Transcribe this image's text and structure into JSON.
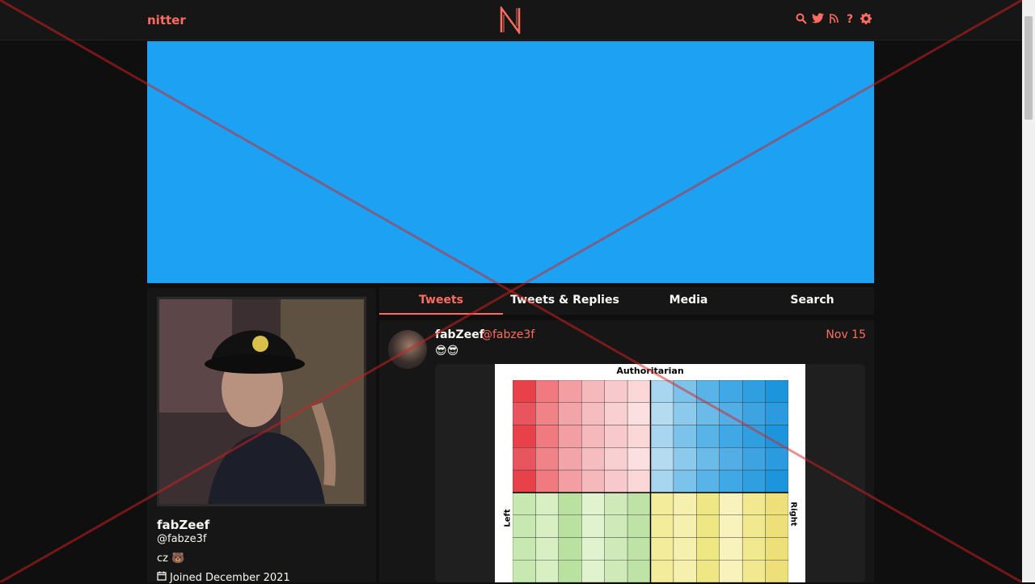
{
  "nav": {
    "brand": "nitter",
    "mark": "N",
    "icons": [
      "search-icon",
      "twitter-icon",
      "rss-icon",
      "help-icon",
      "settings-icon"
    ]
  },
  "profile": {
    "name": "fabZeef",
    "handle": "@fabze3f",
    "bio": "cz 🐻",
    "joined": "Joined December 2021"
  },
  "tabs": [
    {
      "label": "Tweets",
      "active": true
    },
    {
      "label": "Tweets & Replies",
      "active": false
    },
    {
      "label": "Media",
      "active": false
    },
    {
      "label": "Search",
      "active": false
    }
  ],
  "tweet": {
    "name": "fabZeef",
    "username": "@fabze3f",
    "date": "Nov 15",
    "text": "😎😎",
    "image": {
      "title": "Authoritarian",
      "left_label": "Left",
      "right_label": "Right"
    }
  },
  "colors": {
    "accent": "#ff6c60",
    "banner": "#1da1f2",
    "background": "#0f0f0f",
    "panel": "#161616"
  }
}
